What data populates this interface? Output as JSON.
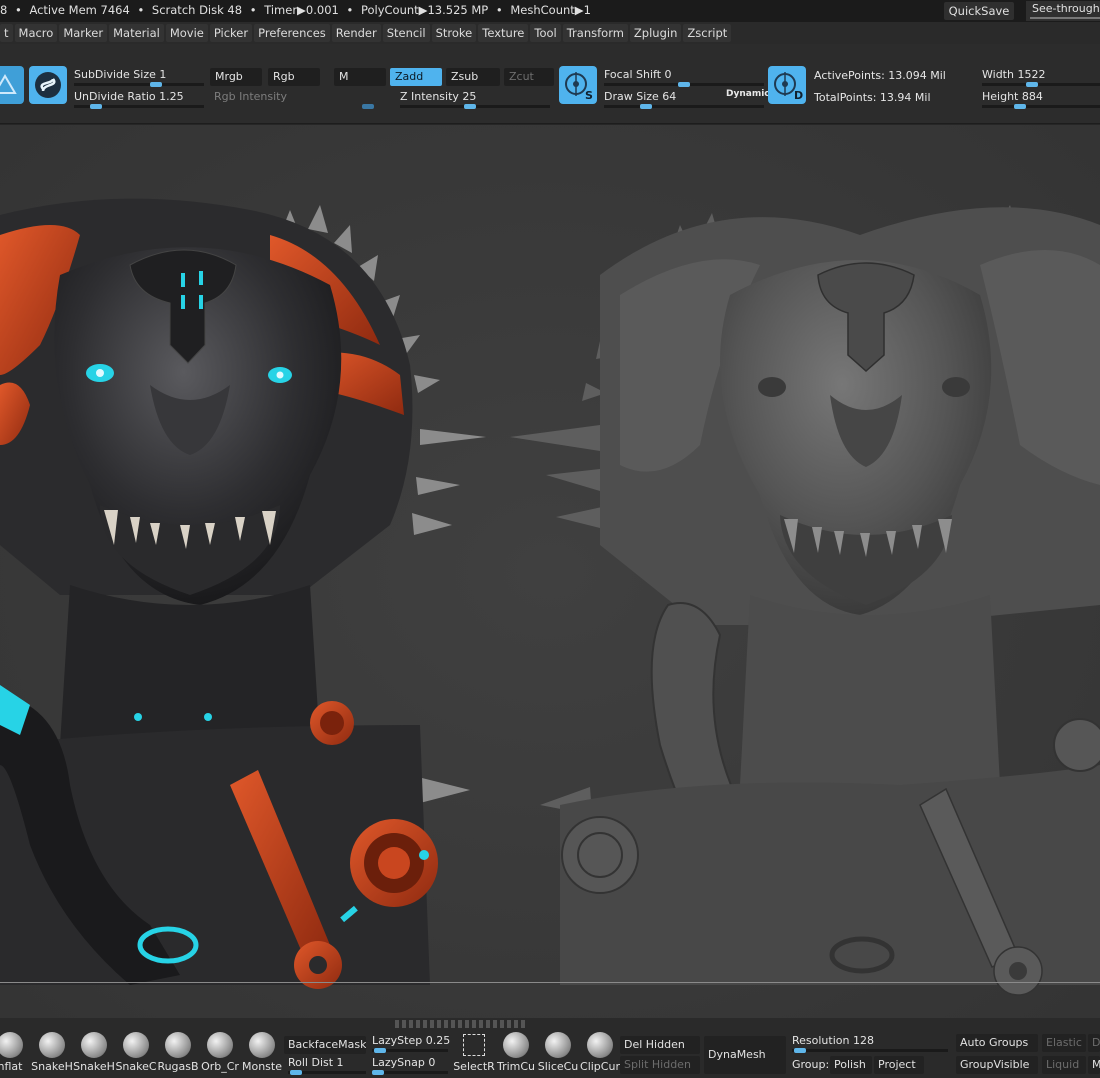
{
  "status": {
    "stats": [
      "8",
      "Active Mem 7464",
      "Scratch Disk 48",
      "Timer▶0.001",
      "PolyCount▶13.525 MP",
      "MeshCount▶1"
    ],
    "quicksave": "QuickSave",
    "seethrough": "See-through"
  },
  "menu": [
    "t",
    "Macro",
    "Marker",
    "Material",
    "Movie",
    "Picker",
    "Preferences",
    "Render",
    "Stencil",
    "Stroke",
    "Texture",
    "Tool",
    "Transform",
    "Zplugin",
    "Zscript"
  ],
  "shelf": {
    "subdivide_size": "SubDivide Size 1",
    "undivide_ratio": "UnDivide Ratio 1.25",
    "mrgb": "Mrgb",
    "rgb": "Rgb",
    "m": "M",
    "rgb_intensity": "Rgb Intensity",
    "zadd": "Zadd",
    "zsub": "Zsub",
    "zcut": "Zcut",
    "z_intensity": "Z Intensity 25",
    "focal_shift": "Focal Shift 0",
    "draw_size": "Draw Size 64",
    "dynamic": "Dynamic",
    "active_points": "ActivePoints: 13.094 Mil",
    "total_points": "TotalPoints: 13.94 Mil",
    "width": "Width 1522",
    "height": "Height 884",
    "s_badge": "S",
    "d_badge": "D"
  },
  "bottom": {
    "brushes": [
      "nflat",
      "SnakeH",
      "SnakeH",
      "SnakeC",
      "RugasB",
      "Orb_Cr",
      "Monste"
    ],
    "backface_mask": "BackfaceMask",
    "roll_dist": "Roll Dist 1",
    "lazy_step": "LazyStep 0.25",
    "lazy_snap": "LazySnap 0",
    "select_tools": [
      "SelectR",
      "TrimCu",
      "SliceCu",
      "ClipCur"
    ],
    "del_hidden": "Del Hidden",
    "split_hidden": "Split Hidden",
    "dynamesh": "DynaMesh",
    "resolution": "Resolution 128",
    "group": "Group:",
    "polish": "Polish",
    "project": "Project",
    "auto_groups": "Auto Groups",
    "group_visible": "GroupVisible",
    "elastic": "Elastic",
    "liquid": "Liquid",
    "d_short": "D",
    "m_short": "M"
  },
  "colors": {
    "accent": "#4fb3ee",
    "skin_dark": "#2a2a2c",
    "armor_orange": "#c9461f",
    "glow_cyan": "#27d3e6",
    "clay_gray": "#5a5a5a"
  },
  "progress": {
    "z_intensity": 0.25,
    "draw_size": 0.15,
    "resolution": 0.08
  }
}
